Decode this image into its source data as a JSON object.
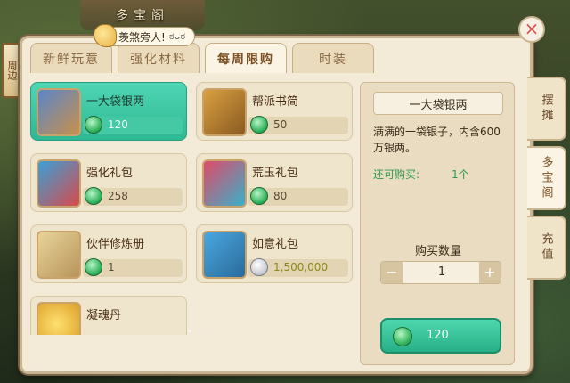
{
  "background": {
    "lantern_label": "周边",
    "window_title": "多宝阁"
  },
  "notice": {
    "text": "羡煞旁人!",
    "emote": "ಠᴗಠ"
  },
  "tabs": [
    {
      "label": "新鲜玩意",
      "active": false
    },
    {
      "label": "强化材料",
      "active": false
    },
    {
      "label": "每周限购",
      "active": true
    },
    {
      "label": "时装",
      "active": false
    }
  ],
  "items": [
    {
      "name": "一大袋银两",
      "price": "120",
      "currency": "jade-icon",
      "selected": true
    },
    {
      "name": "帮派书简",
      "price": "50",
      "currency": "jade-icon",
      "selected": false
    },
    {
      "name": "强化礼包",
      "price": "258",
      "currency": "jade-icon",
      "selected": false
    },
    {
      "name": "荒玉礼包",
      "price": "80",
      "currency": "jade-icon",
      "selected": false
    },
    {
      "name": "伙伴修炼册",
      "price": "1",
      "currency": "jade-icon",
      "selected": false
    },
    {
      "name": "如意礼包",
      "price": "1,500,000",
      "currency": "silver-icon",
      "selected": false
    },
    {
      "name": "凝魂丹",
      "price": "",
      "currency": "",
      "selected": false
    }
  ],
  "detail": {
    "title": "一大袋银两",
    "description": "满满的一袋银子，内含600万银两。",
    "remaining_label": "还可购买:",
    "remaining_value": "1个",
    "quantity_label": "购买数量",
    "minus": "−",
    "plus": "+",
    "quantity": "1",
    "buy_price": "120"
  },
  "side_tabs": [
    {
      "label": "摆摊",
      "active": false
    },
    {
      "label": "多宝阁",
      "active": true
    },
    {
      "label": "充值",
      "active": false
    }
  ],
  "close_symbol": "×",
  "scroll_hint": "⌄",
  "colors": {
    "accent_green": "#2fb894",
    "panel_bg": "#f3ead8",
    "gold_price": "#8c8a18"
  }
}
